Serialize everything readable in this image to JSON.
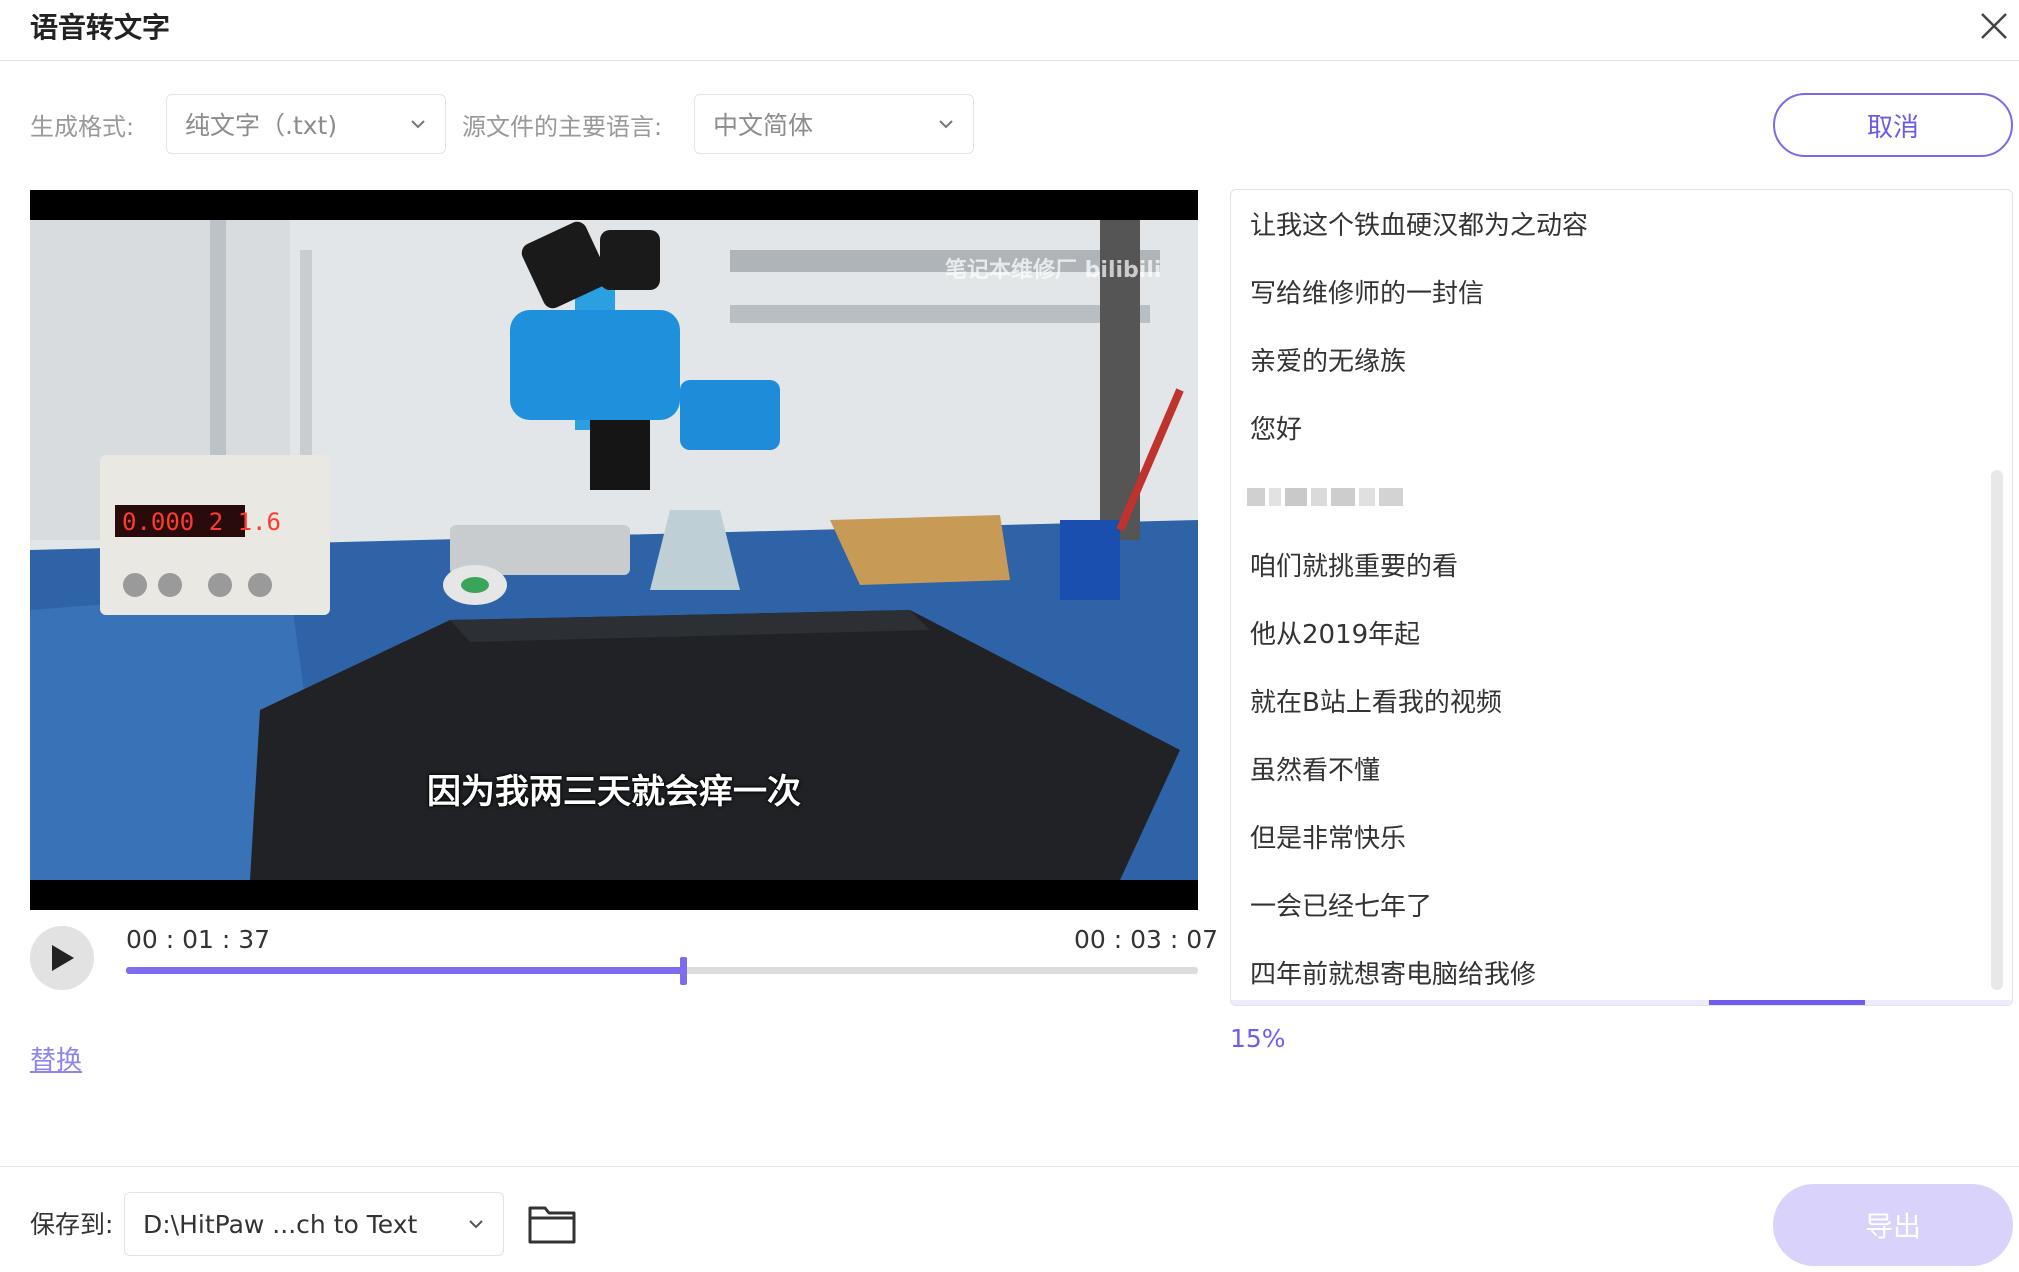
{
  "window": {
    "title": "语音转文字",
    "close_icon": "close-icon"
  },
  "options": {
    "format_label": "生成格式:",
    "format_value": "纯文字（.txt)",
    "language_label": "源文件的主要语言:",
    "language_value": "中文简体",
    "cancel_label": "取消"
  },
  "video": {
    "subtitle": "因为我两三天就会痒一次",
    "watermark": "笔记本维修厂 bilibili",
    "display_value": "0.000 2 1.6"
  },
  "player": {
    "current_time": "00 : 01 : 37",
    "total_time": "00 : 03 : 07",
    "progress": 0.52
  },
  "replace_label": "替换",
  "transcript": {
    "lines": [
      "让我这个铁血硬汉都为之动容",
      "写给维修师的一封信",
      "亲爱的无缘族",
      "您好",
      "",
      "咱们就挑重要的看",
      "他从2019年起",
      "就在B站上看我的视频",
      "虽然看不懂",
      "但是非常快乐",
      "一会已经七年了",
      "四年前就想寄电脑给我修"
    ],
    "progress_label": "15%",
    "progress": 0.15
  },
  "footer": {
    "save_label": "保存到:",
    "path_value": "D:\\HitPaw ...ch to Text",
    "export_label": "导出"
  },
  "colors": {
    "accent": "#6f5df0",
    "export_disabled": "#d9d2fb"
  }
}
